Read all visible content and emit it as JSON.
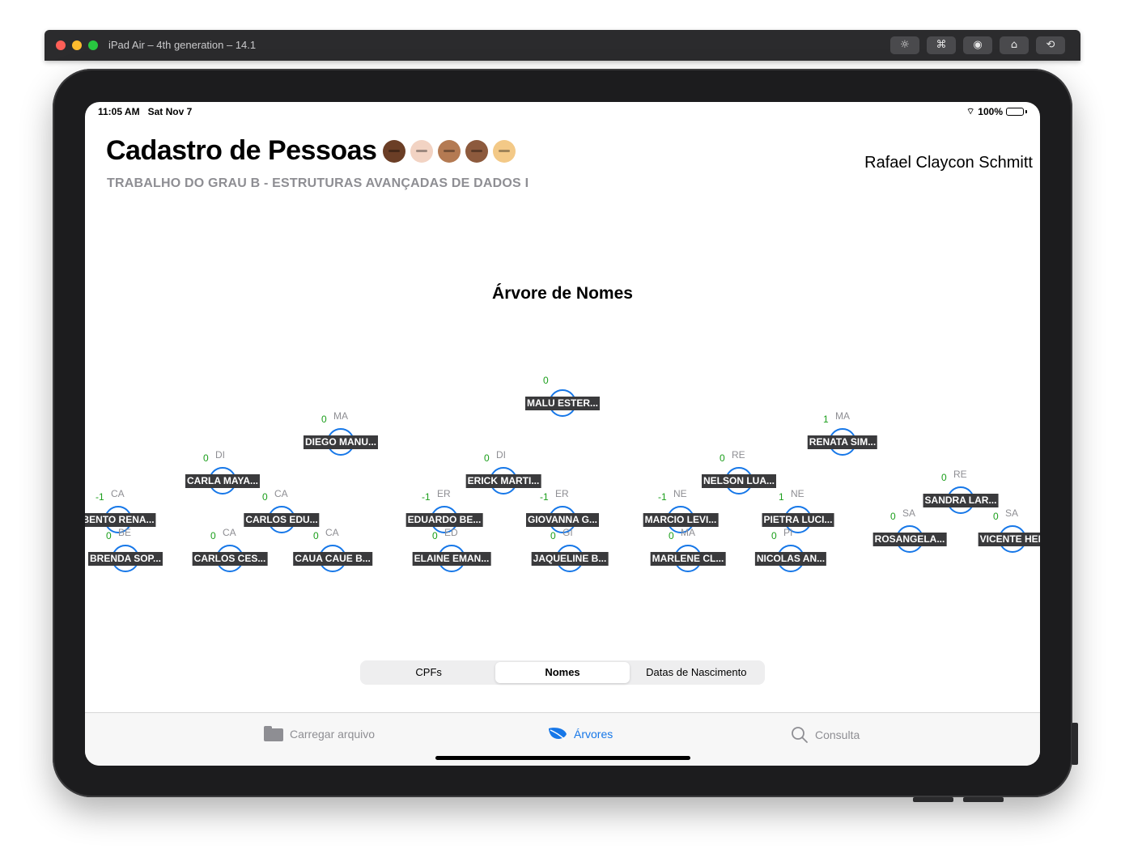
{
  "simulator": {
    "title": "iPad Air – 4th generation – 14.1",
    "buttons": [
      "brightness-icon",
      "command-icon",
      "screenshot-icon",
      "home-icon",
      "rotate-icon"
    ]
  },
  "status_bar": {
    "time": "11:05 AM",
    "date": "Sat Nov 7",
    "battery": "100%"
  },
  "header": {
    "title": "Cadastro de Pessoas",
    "emojis": [
      "#6b3e26",
      "#f2d3c3",
      "#b47a52",
      "#8d5a3d",
      "#f3c987"
    ],
    "subtitle": "TRABALHO DO GRAU B - ESTRUTURAS AVANÇADAS DE DADOS I",
    "author": "Rafael Claycon Schmitt"
  },
  "chart_title": "Árvore de Nomes",
  "tree": {
    "nodes": [
      {
        "id": "n1",
        "label": "MALU ESTER...",
        "balance": "0",
        "prefix": ""
      },
      {
        "id": "n2",
        "label": "DIEGO MANU...",
        "balance": "0",
        "prefix": "MA"
      },
      {
        "id": "n3",
        "label": "RENATA SIM...",
        "balance": "1",
        "prefix": "MA"
      },
      {
        "id": "n4",
        "label": "CARLA MAYA...",
        "balance": "0",
        "prefix": "DI"
      },
      {
        "id": "n5",
        "label": "ERICK MARTI...",
        "balance": "0",
        "prefix": "DI"
      },
      {
        "id": "n6",
        "label": "NELSON LUA...",
        "balance": "0",
        "prefix": "RE"
      },
      {
        "id": "n7",
        "label": "SANDRA LAR...",
        "balance": "0",
        "prefix": "RE"
      },
      {
        "id": "n8",
        "label": "BENTO RENA...",
        "balance": "-1",
        "prefix": "CA"
      },
      {
        "id": "n9",
        "label": "CARLOS EDU...",
        "balance": "0",
        "prefix": "CA"
      },
      {
        "id": "n10",
        "label": "EDUARDO BE...",
        "balance": "-1",
        "prefix": "ER"
      },
      {
        "id": "n11",
        "label": "GIOVANNA G...",
        "balance": "-1",
        "prefix": "ER"
      },
      {
        "id": "n12",
        "label": "MARCIO LEVI...",
        "balance": "-1",
        "prefix": "NE"
      },
      {
        "id": "n13",
        "label": "PIETRA LUCI...",
        "balance": "1",
        "prefix": "NE"
      },
      {
        "id": "n14",
        "label": "ROSANGELA...",
        "balance": "0",
        "prefix": "SA"
      },
      {
        "id": "n15",
        "label": "VICENTE HEN",
        "balance": "0",
        "prefix": "SA"
      },
      {
        "id": "n16",
        "label": "BRENDA SOP...",
        "balance": "0",
        "prefix": "BE"
      },
      {
        "id": "n17",
        "label": "CARLOS CES...",
        "balance": "0",
        "prefix": "CA"
      },
      {
        "id": "n18",
        "label": "CAUA CAUE B...",
        "balance": "0",
        "prefix": "CA"
      },
      {
        "id": "n19",
        "label": "ELAINE EMAN...",
        "balance": "0",
        "prefix": "ED"
      },
      {
        "id": "n20",
        "label": "JAQUELINE B...",
        "balance": "0",
        "prefix": "GI"
      },
      {
        "id": "n21",
        "label": "MARLENE CL...",
        "balance": "0",
        "prefix": "MA"
      },
      {
        "id": "n22",
        "label": "NICOLAS AN...",
        "balance": "0",
        "prefix": "PI"
      }
    ]
  },
  "segmented_control": {
    "options": [
      "CPFs",
      "Nomes",
      "Datas de Nascimento"
    ],
    "selected": "Nomes"
  },
  "tab_bar": {
    "items": [
      {
        "label": "Carregar arquivo",
        "icon": "folder-icon"
      },
      {
        "label": "Árvores",
        "icon": "leaf-icon"
      },
      {
        "label": "Consulta",
        "icon": "magnifying-glass-icon"
      }
    ],
    "active": "Árvores"
  },
  "colors": {
    "accent": "#1677e8",
    "balance": "#1a9e1a",
    "label_bg": "#3a3a3c",
    "secondary_text": "#8e8e93"
  }
}
